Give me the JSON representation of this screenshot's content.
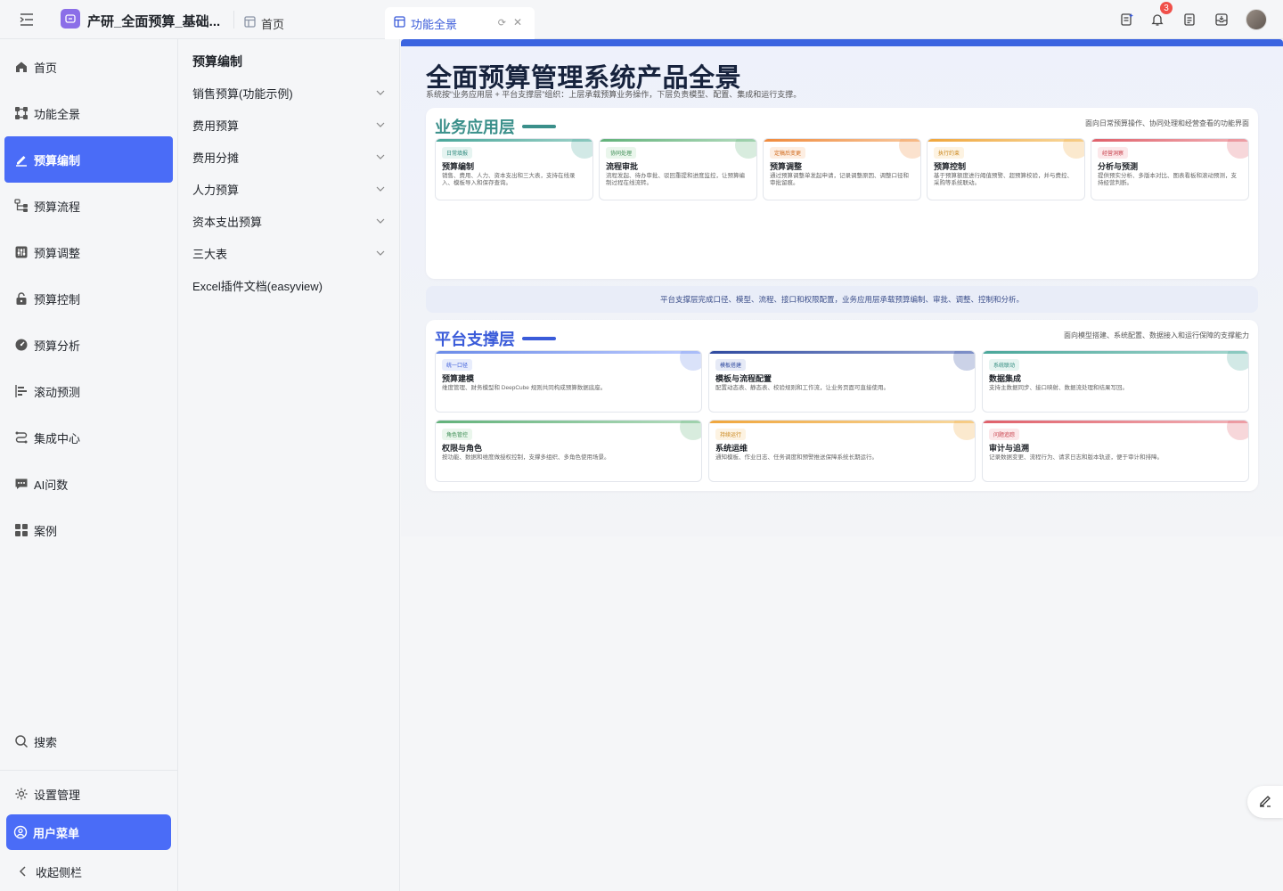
{
  "app": {
    "title": "产研_全面预算_基础..."
  },
  "tabs": [
    {
      "label": "首页"
    },
    {
      "label": "功能全景"
    }
  ],
  "notifications": {
    "count": "3"
  },
  "sidebar": {
    "items": [
      {
        "label": "首页",
        "icon": "home-icon"
      },
      {
        "label": "功能全景",
        "icon": "overview-icon"
      },
      {
        "label": "预算编制",
        "icon": "edit-icon"
      },
      {
        "label": "预算流程",
        "icon": "flow-icon"
      },
      {
        "label": "预算调整",
        "icon": "adjust-icon"
      },
      {
        "label": "预算控制",
        "icon": "lock-icon"
      },
      {
        "label": "预算分析",
        "icon": "dashboard-icon"
      },
      {
        "label": "滚动预测",
        "icon": "forecast-icon"
      },
      {
        "label": "集成中心",
        "icon": "integration-icon"
      },
      {
        "label": "AI问数",
        "icon": "chat-icon"
      },
      {
        "label": "案例",
        "icon": "grid-icon"
      }
    ],
    "search": "搜索",
    "settings": "设置管理",
    "user_menu": "用户菜单",
    "collapse": "收起侧栏"
  },
  "subnav": {
    "title": "预算编制",
    "items": [
      {
        "label": "销售预算(功能示例)"
      },
      {
        "label": "费用预算"
      },
      {
        "label": "费用分摊"
      },
      {
        "label": "人力预算"
      },
      {
        "label": "资本支出预算"
      },
      {
        "label": "三大表"
      },
      {
        "label": "Excel插件文档(easyview)"
      }
    ]
  },
  "page": {
    "title": "全面预算管理系统产品全景",
    "subtitle": "系统按“业务应用层 + 平台支撑层”组织：上层承载预算业务操作，下层负责模型、配置、集成和运行支撑。",
    "bridge": "平台支撑层完成口径、模型、流程、接口和权限配置，业务应用层承载预算编制、审批、调整、控制和分析。"
  },
  "biz_layer": {
    "title": "业务应用层",
    "note": "面向日常预算操作、协同处理和经营查看的功能界面",
    "cards": [
      {
        "tag": "日常填报",
        "title": "预算编制",
        "desc": "销售、费用、人力、资本支出和三大表，支持在线录入、模板导入和保存查询。"
      },
      {
        "tag": "协同处理",
        "title": "流程审批",
        "desc": "流程发起、待办审批、驳回重提和进度监控，让预算编制过程在线流转。"
      },
      {
        "tag": "定稿后变更",
        "title": "预算调整",
        "desc": "通过预算调整单发起申请，记录调整原因、调整口径和审批留痕。"
      },
      {
        "tag": "执行约束",
        "title": "预算控制",
        "desc": "基于预算额度进行阈值预警、超预算校验，并与费控、采购等系统联动。"
      },
      {
        "tag": "经营洞察",
        "title": "分析与预测",
        "desc": "提供预实分析、多版本对比、图表看板和滚动预测，支持经营判断。"
      }
    ]
  },
  "plat_layer": {
    "title": "平台支撑层",
    "note": "面向模型搭建、系统配置、数据接入和运行保障的支撑能力",
    "cards": [
      {
        "tag": "统一口径",
        "title": "预算建模",
        "desc": "维度管理、财务模型和 DeepCube 规则共同构成预算数据底座。"
      },
      {
        "tag": "模板搭建",
        "title": "模板与流程配置",
        "desc": "配置动态表、静态表、校验规则和工作流，让业务页面可直接使用。"
      },
      {
        "tag": "系统联动",
        "title": "数据集成",
        "desc": "支持主数据同步、接口映射、数据流处理和结果写回。"
      },
      {
        "tag": "角色管控",
        "title": "权限与角色",
        "desc": "按功能、数据和维度做授权控制，支撑多组织、多角色使用场景。"
      },
      {
        "tag": "持续运行",
        "title": "系统运维",
        "desc": "通知模板、作业日志、任务调度和预警推送保障系统长期运行。"
      },
      {
        "tag": "问题追踪",
        "title": "审计与追溯",
        "desc": "记录数据变更、流程行为、请求日志和版本轨迹，便于审计和排障。"
      }
    ]
  },
  "colors": {
    "accent": "#4a6cf7",
    "biz_title": "#3a8f8a",
    "plat_title": "#3a5bd9",
    "teal": "#4aa79a",
    "green": "#62b27a",
    "orange": "#f08a3c",
    "amber": "#f0a63c",
    "red": "#e0606a",
    "navy": "#2f4aa0"
  }
}
